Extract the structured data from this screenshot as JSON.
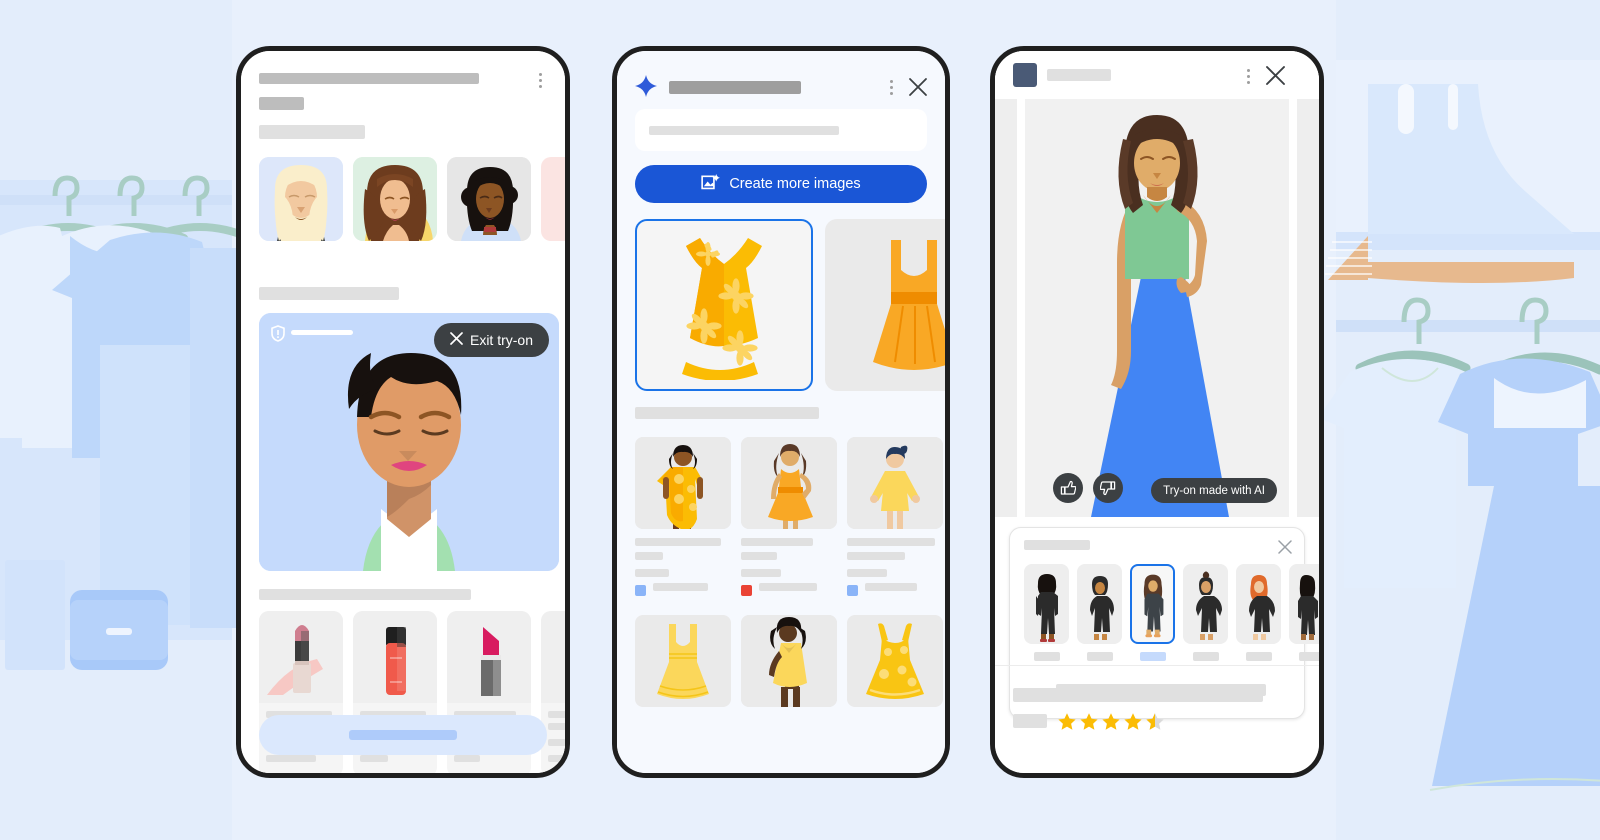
{
  "page": {
    "background_color": "#e8f0fc",
    "title": "AI virtual try-on shopping app mockups"
  },
  "phone1": {
    "name": "beauty-try-on-screen",
    "kebab_icon": "more-vert-icon",
    "avatars": [
      {
        "name": "avatar-blonde-woman",
        "bg": "#dde7fa"
      },
      {
        "name": "avatar-brunette-woman",
        "bg": "#ddf0e2"
      },
      {
        "name": "avatar-dark-skin-woman",
        "bg": "#e6e6e6"
      },
      {
        "name": "avatar-partial-card",
        "bg": "#fbe4e2"
      }
    ],
    "stage": {
      "shield_icon": "shield-privacy-icon",
      "exit_label": "Exit try-on",
      "exit_icon": "close-icon",
      "background": "#c5dafc"
    },
    "products": [
      {
        "name": "product-lipstick-pink",
        "swatch": "#d98a9e"
      },
      {
        "name": "product-lip-gloss-coral",
        "swatch": "#f05a4b"
      },
      {
        "name": "product-lipstick-magenta",
        "swatch": "#d81b60"
      },
      {
        "name": "product-partial-card",
        "swatch": "#e0e0e0"
      }
    ],
    "cta_name": "primary-cta-button"
  },
  "phone2": {
    "name": "ai-image-generation-screen",
    "sparkle_icon": "ai-sparkle-icon",
    "kebab_icon": "more-vert-icon",
    "close_icon": "close-icon",
    "search_placeholder": "",
    "create_button": {
      "label": "Create more images",
      "icon": "add-image-icon",
      "color": "#1a56d6"
    },
    "hero_items": [
      {
        "name": "dress-wrap-floral-selected",
        "selected": true
      },
      {
        "name": "dress-sleeveless-orange",
        "selected": false
      }
    ],
    "results_row1": [
      {
        "name": "model-card-floral-wrap-dress",
        "swatch": "#8ab4f8"
      },
      {
        "name": "model-card-orange-skater-dress",
        "swatch": "#ea4335"
      },
      {
        "name": "model-card-yellow-sweater-dress",
        "swatch": "#8ab4f8"
      }
    ],
    "results_row2": [
      {
        "name": "product-card-yellow-tank-dress"
      },
      {
        "name": "model-card-yellow-v-dress"
      },
      {
        "name": "product-card-yellow-floral-dress"
      }
    ]
  },
  "phone3": {
    "name": "product-try-on-detail-screen",
    "logo_icon": "brand-logo-icon",
    "kebab_icon": "more-vert-icon",
    "close_icon": "close-icon",
    "hero": {
      "name": "try-on-result-image",
      "top_color": "#7fc894",
      "skirt_color": "#4285f4"
    },
    "reactions": {
      "like_icon": "thumb-up-icon",
      "dislike_icon": "thumb-down-icon"
    },
    "ai_badge": "Try-on made with AI",
    "model_picker": {
      "name": "model-size-picker",
      "close_icon": "close-icon",
      "models": [
        {
          "name": "model-option-1",
          "selected": false,
          "hair": "#1f1f1f",
          "skin": "#8d5524"
        },
        {
          "name": "model-option-2",
          "selected": false,
          "hair": "#2b2b2b",
          "skin": "#c68642"
        },
        {
          "name": "model-option-3",
          "selected": true,
          "hair": "#5a3a28",
          "skin": "#e0ac69"
        },
        {
          "name": "model-option-4",
          "selected": false,
          "hair": "#4a2f20",
          "skin": "#d9a066"
        },
        {
          "name": "model-option-5",
          "selected": false,
          "hair": "#e06a2b",
          "skin": "#f0c9a0"
        },
        {
          "name": "model-option-6",
          "selected": false,
          "hair": "#1f1f1f",
          "skin": "#a06a3a"
        }
      ]
    },
    "rating": {
      "name": "star-rating",
      "value": 4.5,
      "max": 5,
      "star_color": "#fbbc04",
      "empty_color": "#dadada"
    }
  }
}
